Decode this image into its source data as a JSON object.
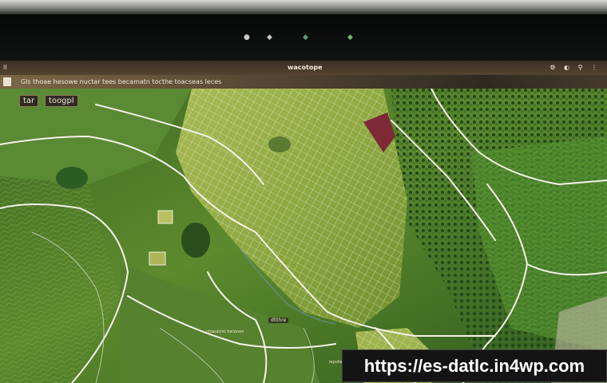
{
  "top_bar": {
    "glyphs": [
      "●",
      "◆",
      "◆",
      "◆"
    ]
  },
  "window": {
    "title": "wacotope",
    "left_icon_label": "ll",
    "controls": "⚙ ◐ ⚲ ⋮"
  },
  "address_bar": {
    "text": "Gls thoae hesowe nuctar tees becamatn tocthe toacseas leces"
  },
  "map": {
    "label_main_left": "tar",
    "label_main_right": "toogpl",
    "label_small_1": "dltlhre",
    "label_small_2": "ctoaulchtl hwlonen",
    "label_small_3": "lepulle",
    "colors": {
      "valley": "#819f3a",
      "forest": "#2f5a1f",
      "hills": "#56812f",
      "roads": "#f4f1e8",
      "plot_accent": "#7d2a36"
    }
  },
  "watermark": {
    "url": "https://es-datlc.in4wp.com"
  }
}
